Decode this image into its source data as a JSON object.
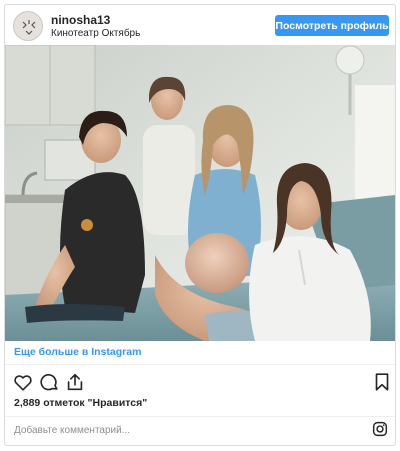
{
  "post": {
    "username": "ninosha13",
    "location": "Кинотеатр Октябрь",
    "view_profile_label": "Посмотреть профиль",
    "more_link": "Еще больше в Instagram",
    "likes_text": "2,889 отметок \"Нравится\"",
    "comment_placeholder": "Добавьте комментарий..."
  },
  "icons": {
    "like": "heart-icon",
    "comment": "comment-icon",
    "share": "share-icon",
    "save": "bookmark-icon",
    "instagram": "instagram-icon"
  },
  "colors": {
    "accent": "#3897f0",
    "text": "#262626",
    "muted": "#8e8e8e",
    "border": "#dbdbdb"
  }
}
